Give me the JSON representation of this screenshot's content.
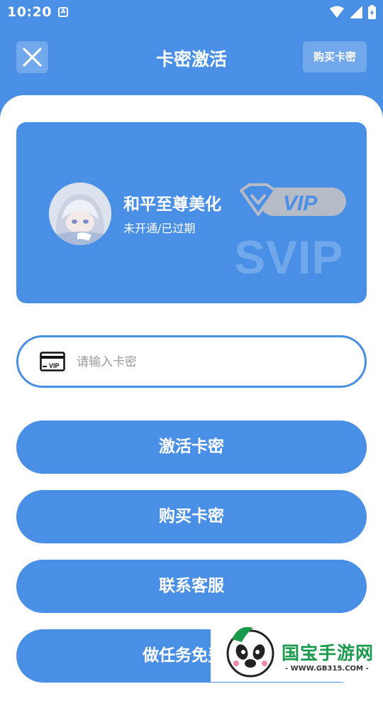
{
  "status_bar": {
    "time": "10:20",
    "notification_letter": "A"
  },
  "header": {
    "title": "卡密激活",
    "buy_button": "购买卡密",
    "close_icon": "close-icon"
  },
  "vip_card": {
    "user_name": "和平至尊美化",
    "status": "未开通/已过期",
    "badge_text": "VIP",
    "watermark_text": "SVIP"
  },
  "input": {
    "placeholder": "请输入卡密",
    "value": "",
    "icon": "vip-card-icon",
    "icon_text": "VIP"
  },
  "buttons": {
    "activate": "激活卡密",
    "buy": "购买卡密",
    "contact": "联系客服",
    "task": "做任务免费激"
  },
  "watermark": {
    "brand": "国宝手游网",
    "url": "- WWW.GB315.COM -"
  },
  "colors": {
    "primary": "#4a8fe6",
    "white": "#ffffff",
    "watermark_green": "#1a9a4c"
  }
}
